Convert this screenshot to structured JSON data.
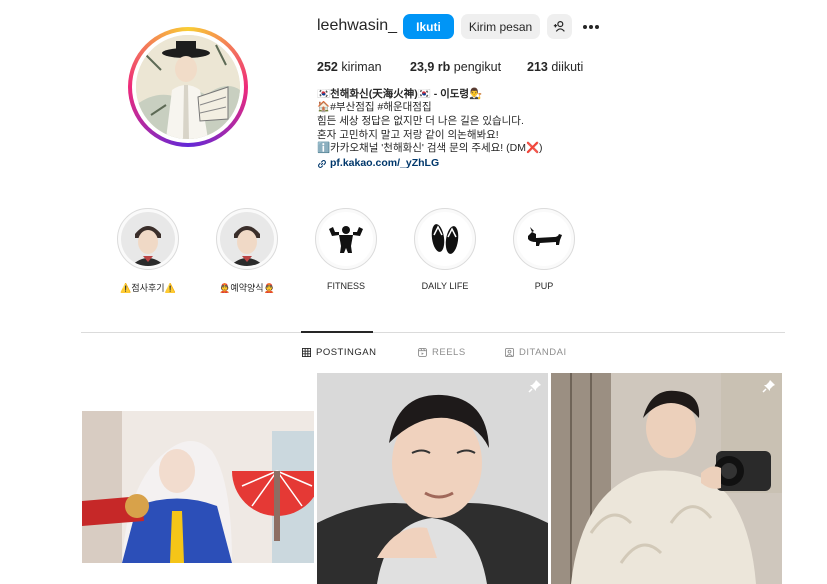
{
  "profile": {
    "username": "leehwasin_",
    "follow_label": "Ikuti",
    "message_label": "Kirim pesan",
    "add_user_icon": "add-user-icon",
    "more_icon": "more-options-icon"
  },
  "stats": {
    "posts_value": "252",
    "posts_label": "kiriman",
    "followers_value": "23,9 rb",
    "followers_label": "pengikut",
    "following_value": "213",
    "following_label": "diikuti"
  },
  "bio": {
    "name": "🇰🇷천해화신(天海火神)🇰🇷 - 이도령👨‍⚖️",
    "line1": "🏠#부산점집 #해운대점집",
    "line2": "힘든 세상 정답은 없지만 더 나은 길은 있습니다.",
    "line3": "혼자 고민하지 말고 저랑 같이 의논해봐요!",
    "line4": "ℹ️카카오채널 '천해화신' 검색 문의 주세요! (DM❌)",
    "link": "pf.kakao.com/_yZhLG"
  },
  "highlights": [
    {
      "label": "⚠️점사후기⚠️"
    },
    {
      "label": "👲예약양식👲"
    },
    {
      "label": "FITNESS"
    },
    {
      "label": "DAILY LIFE"
    },
    {
      "label": "PUP"
    }
  ],
  "tabs": {
    "posts": "POSTINGAN",
    "reels": "REELS",
    "tagged": "DITANDAI"
  },
  "colors": {
    "accent": "#0095f6",
    "text": "#262626",
    "secondary_text": "#8e8e8e",
    "border": "#dbdbdb"
  }
}
